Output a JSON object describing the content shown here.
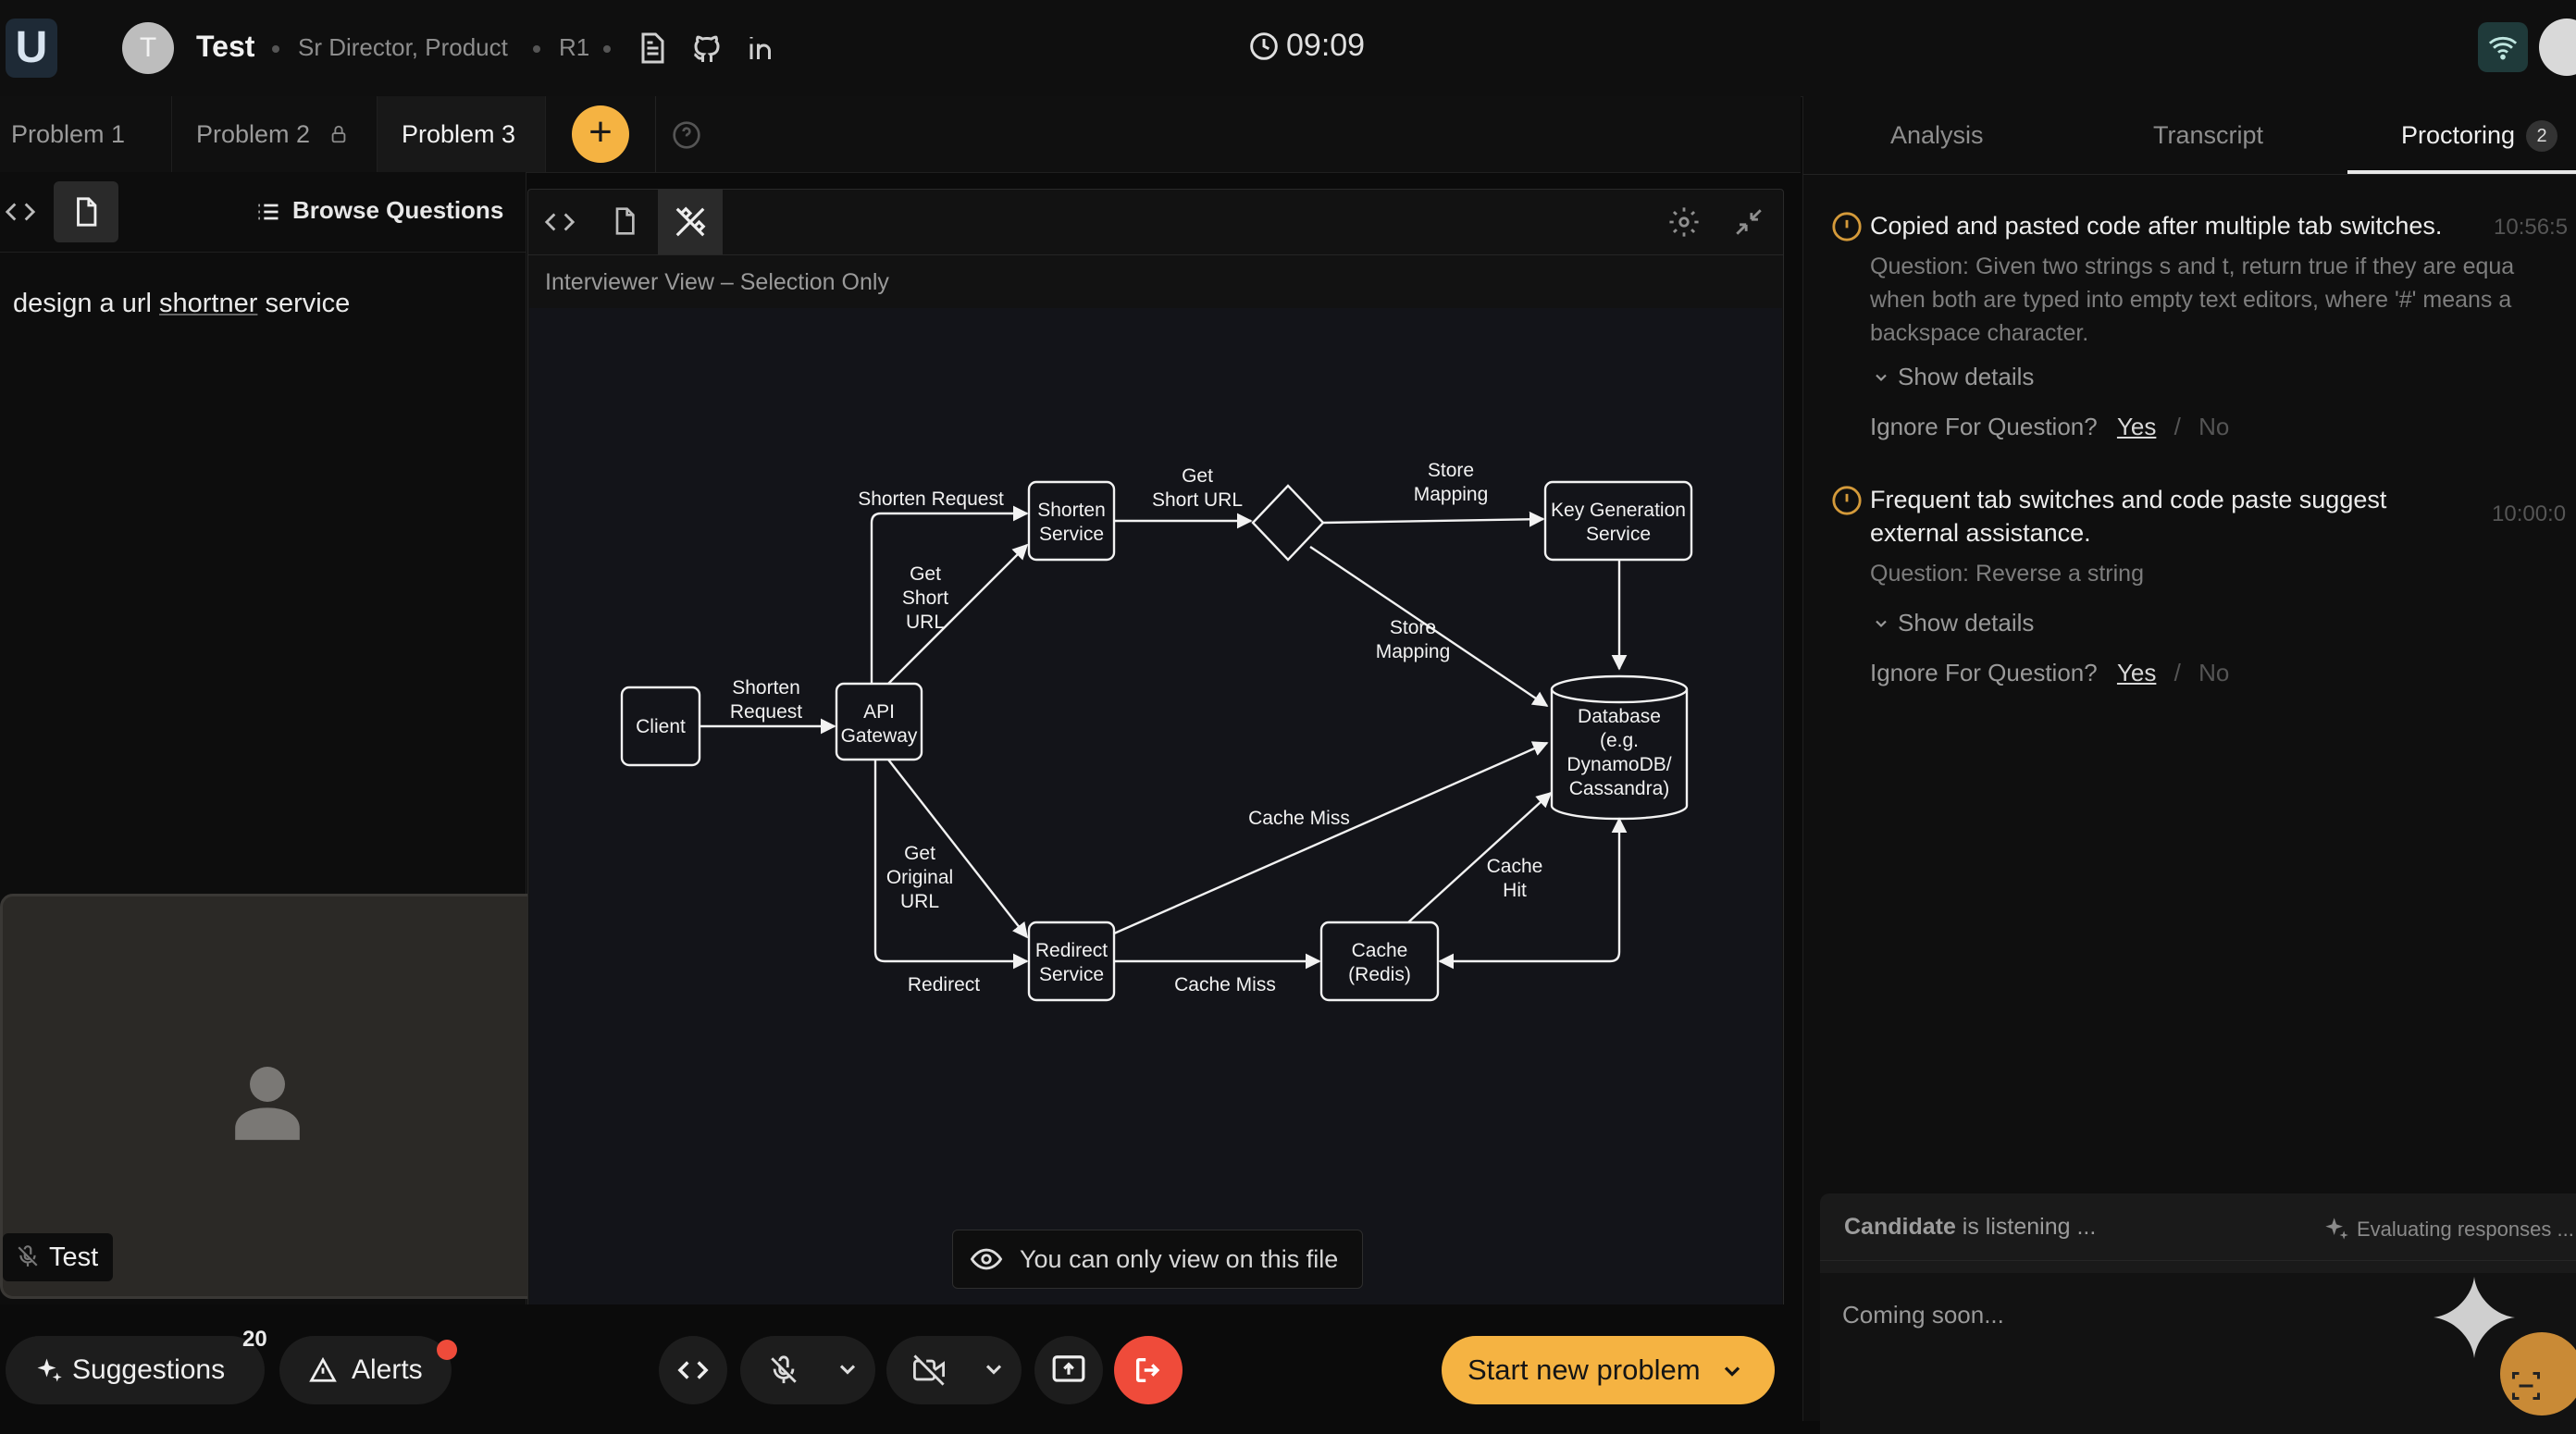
{
  "header": {
    "logo": "U",
    "avatar_initial": "T",
    "candidate_name": "Test",
    "role": "Sr Director, Product",
    "round": "R1",
    "timer": "09:09",
    "icons": [
      "resume-icon",
      "github-icon",
      "linkedin-icon"
    ]
  },
  "tabs": [
    {
      "label": "Problem 1",
      "locked": true
    },
    {
      "label": "Problem 2",
      "locked": true
    },
    {
      "label": "Problem 3",
      "locked": false,
      "active": true
    }
  ],
  "left": {
    "browse_label": "Browse Questions",
    "prompt_pre": "design a  url ",
    "prompt_underlined": "shortner",
    "prompt_post": " service",
    "participant_name": "Test"
  },
  "center": {
    "view_label": "Interviewer View – Selection Only",
    "toast": "You can only view on this file",
    "diagram": {
      "nodes": {
        "client": "Client",
        "gateway": [
          "API",
          "Gateway"
        ],
        "shorten": [
          "Shorten",
          "Service"
        ],
        "redirect": [
          "Redirect",
          "Service"
        ],
        "keygen": [
          "Key Generation",
          "Service"
        ],
        "database": [
          "Database",
          "(e.g.",
          "DynamoDB/",
          "Cassandra)"
        ],
        "cache": [
          "Cache",
          "(Redis)"
        ]
      },
      "edges": {
        "client_gateway": [
          "Shorten",
          "Request"
        ],
        "gateway_shorten_top": "Shorten Request",
        "gateway_shorten_diag": [
          "Get",
          "Short",
          "URL"
        ],
        "shorten_decision": [
          "Get",
          "Short URL"
        ],
        "decision_keygen": [
          "Store",
          "Mapping"
        ],
        "decision_db": [
          "Store",
          "Mapping"
        ],
        "gateway_redirect_diag": [
          "Get",
          "Original",
          "URL"
        ],
        "gateway_redirect_bottom": "Redirect",
        "redirect_db": "Cache Miss",
        "redirect_cache": "Cache Miss",
        "cache_db": [
          "Cache",
          "Hit"
        ]
      }
    }
  },
  "right": {
    "tabs": [
      {
        "label": "Analysis"
      },
      {
        "label": "Transcript"
      },
      {
        "label": "Proctoring",
        "badge": "2",
        "active": true
      }
    ],
    "alerts": [
      {
        "title": "Copied and pasted code after multiple tab switches.",
        "time": "10:56:5",
        "question_lines": [
          "Question: Given two strings s and t, return true if they are equa",
          "when both are typed into empty text editors, where '#' means a",
          "backspace character."
        ],
        "show_details": "Show details",
        "ignore_label": "Ignore For Question?",
        "yes": "Yes",
        "sep": "/",
        "no": "No"
      },
      {
        "title_lines": [
          "Frequent tab switches and code paste suggest",
          "external assistance."
        ],
        "time": "10:00:0",
        "question_lines": [
          "Question: Reverse a string"
        ],
        "show_details": "Show details",
        "ignore_label": "Ignore For Question?",
        "yes": "Yes",
        "sep": "/",
        "no": "No"
      }
    ],
    "listen_strong": "Candidate",
    "listen_rest": " is listening ...",
    "evaluating": "Evaluating responses ...",
    "coming_soon": "Coming soon..."
  },
  "bottom": {
    "suggestions_label": "Suggestions",
    "suggestions_count": "20",
    "alerts_label": "Alerts",
    "start_label": "Start new problem"
  },
  "colors": {
    "accent": "#f5b342",
    "danger": "#ef4b3a",
    "background": "#0b0b0b"
  }
}
